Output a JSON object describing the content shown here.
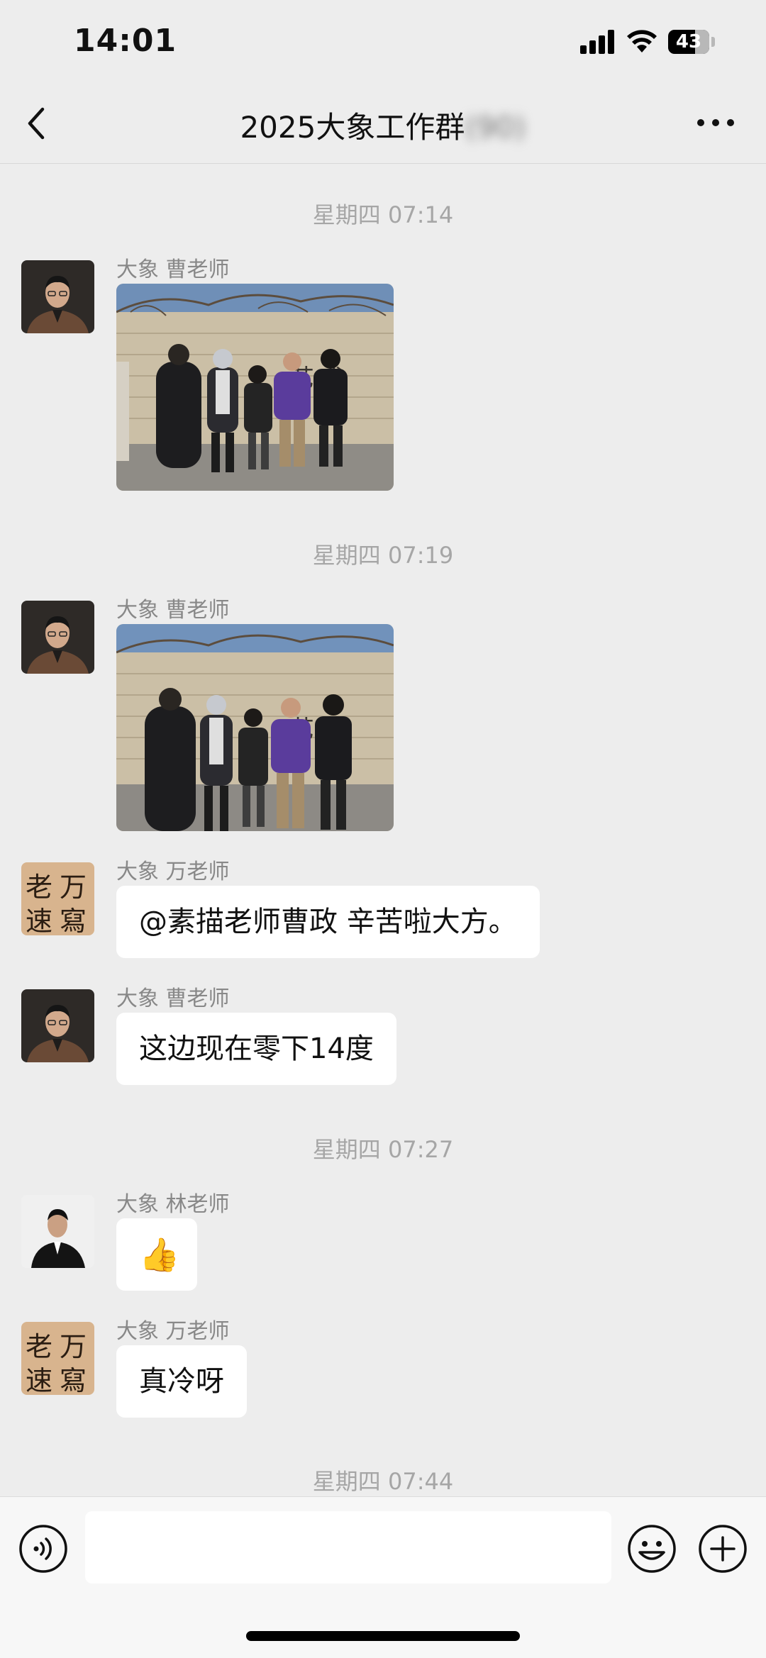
{
  "status_bar": {
    "time": "14:01",
    "battery": "43"
  },
  "header": {
    "title": "2025大象工作群",
    "title_obscured": "(90)"
  },
  "chat": {
    "dividers": [
      "星期四 07:14",
      "星期四 07:19",
      "星期四 07:27",
      "星期四 07:44"
    ],
    "messages": [
      {
        "sender": "大象 曹老师",
        "type": "image"
      },
      {
        "sender": "大象 曹老师",
        "type": "image"
      },
      {
        "sender": "大象 万老师",
        "type": "text",
        "text": "@素描老师曹政 辛苦啦大方。"
      },
      {
        "sender": "大象 曹老师",
        "type": "text",
        "text": "这边现在零下14度"
      },
      {
        "sender": "大象 林老师",
        "type": "emoji",
        "text": "👍"
      },
      {
        "sender": "大象 万老师",
        "type": "text",
        "text": "真冷呀"
      }
    ],
    "avatar_calligraphy": [
      "老",
      "万",
      "速",
      "寫"
    ]
  },
  "input_bar": {
    "placeholder": ""
  },
  "colors": {
    "background": "#ededed",
    "bubble": "#ffffff",
    "meta_text": "#888888"
  }
}
